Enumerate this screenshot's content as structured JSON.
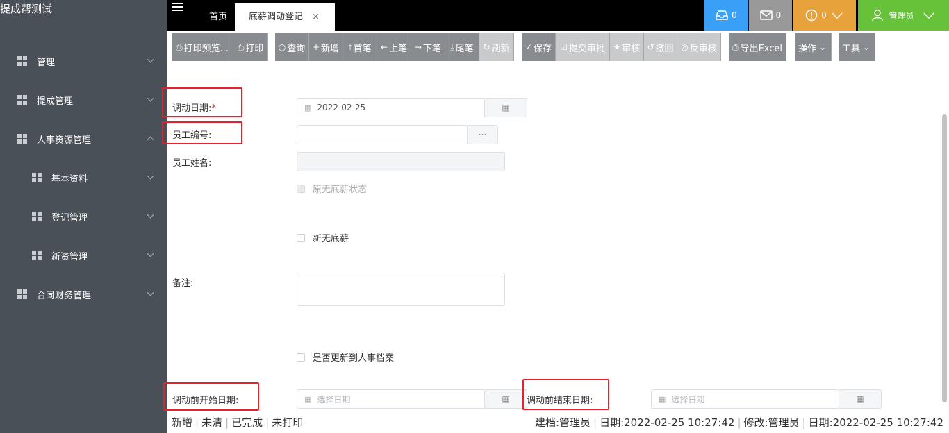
{
  "app": {
    "title": "提成帮测试"
  },
  "sidebar": {
    "items": [
      {
        "label": "管理",
        "sub": false,
        "expanded": false
      },
      {
        "label": "提成管理",
        "sub": false,
        "expanded": false
      },
      {
        "label": "人事资源管理",
        "sub": false,
        "expanded": true
      },
      {
        "label": "基本资料",
        "sub": true,
        "expanded": false
      },
      {
        "label": "登记管理",
        "sub": true,
        "expanded": false
      },
      {
        "label": "新资管理",
        "sub": true,
        "expanded": false
      },
      {
        "label": "合同财务管理",
        "sub": false,
        "expanded": false
      }
    ]
  },
  "tabs": {
    "home": "首页",
    "active": "底薪调动登记",
    "close": "×"
  },
  "topbar": {
    "inbox_count": "0",
    "mail_count": "0",
    "alert_count": "0",
    "user": "管理员",
    "colors": {
      "inbox": "#3a9ff6",
      "mail": "#999999",
      "alert": "#e8a23c",
      "user": "#67c23a"
    }
  },
  "toolbar": {
    "print_preview": "打印预览...",
    "print": "打印",
    "query": "查询",
    "add": "新增",
    "first": "首笔",
    "prev": "上笔",
    "next": "下笔",
    "last": "尾笔",
    "refresh": "刷新",
    "save": "保存",
    "submit": "提交审批",
    "audit": "审核",
    "revoke": "撤回",
    "unaudit": "反审核",
    "export": "导出Excel",
    "operate": "操作",
    "tools": "工具"
  },
  "form": {
    "change_date_label": "调动日期:",
    "change_date_required": "*",
    "change_date_value": "2022-02-25",
    "emp_no_label": "员工编号:",
    "emp_no_value": "",
    "emp_no_picker": "···",
    "emp_name_label": "员工姓名:",
    "emp_name_value": "",
    "orig_no_base": "原无底薪状态",
    "new_no_base": "新无底薪",
    "remark_label": "备注:",
    "update_archive": "是否更新到人事档案",
    "before_start_label": "调动前开始日期:",
    "before_start_placeholder": "选择日期",
    "before_end_label": "调动前结束日期:",
    "before_end_placeholder": "选择日期"
  },
  "status": {
    "s1": "新增",
    "s2": "未清",
    "s3": "已完成",
    "s4": "未打印",
    "created": "建档:管理员",
    "created_date": "日期:2022-02-25 10:27:42",
    "modified": "修改:管理员",
    "modified_date": "日期:2022-02-25 10:27:42"
  }
}
